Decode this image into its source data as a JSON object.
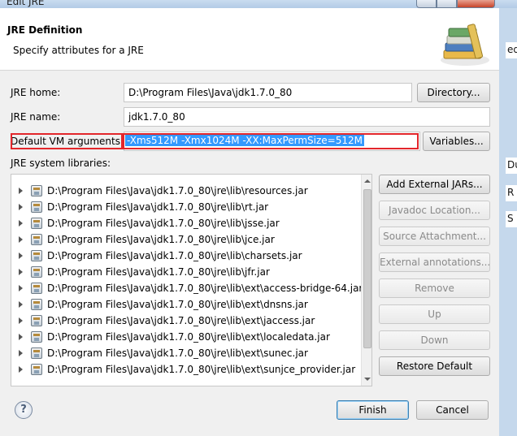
{
  "window": {
    "title": "Edit JRE"
  },
  "header": {
    "title": "JRE Definition",
    "subtitle": "Specify attributes for a JRE"
  },
  "form": {
    "jre_home_label": "JRE home:",
    "jre_home_value": "D:\\Program Files\\Java\\jdk1.7.0_80",
    "directory_button": "Directory...",
    "jre_name_label": "JRE name:",
    "jre_name_value": "jdk1.7.0_80",
    "vm_args_label": "Default VM arguments:",
    "vm_args_value": "-Xms512M -Xmx1024M -XX:MaxPermSize=512M",
    "variables_button": "Variables...",
    "libraries_label": "JRE system libraries:"
  },
  "libraries": [
    "D:\\Program Files\\Java\\jdk1.7.0_80\\jre\\lib\\resources.jar",
    "D:\\Program Files\\Java\\jdk1.7.0_80\\jre\\lib\\rt.jar",
    "D:\\Program Files\\Java\\jdk1.7.0_80\\jre\\lib\\jsse.jar",
    "D:\\Program Files\\Java\\jdk1.7.0_80\\jre\\lib\\jce.jar",
    "D:\\Program Files\\Java\\jdk1.7.0_80\\jre\\lib\\charsets.jar",
    "D:\\Program Files\\Java\\jdk1.7.0_80\\jre\\lib\\jfr.jar",
    "D:\\Program Files\\Java\\jdk1.7.0_80\\jre\\lib\\ext\\access-bridge-64.jar",
    "D:\\Program Files\\Java\\jdk1.7.0_80\\jre\\lib\\ext\\dnsns.jar",
    "D:\\Program Files\\Java\\jdk1.7.0_80\\jre\\lib\\ext\\jaccess.jar",
    "D:\\Program Files\\Java\\jdk1.7.0_80\\jre\\lib\\ext\\localedata.jar",
    "D:\\Program Files\\Java\\jdk1.7.0_80\\jre\\lib\\ext\\sunec.jar",
    "D:\\Program Files\\Java\\jdk1.7.0_80\\jre\\lib\\ext\\sunjce_provider.jar"
  ],
  "side_buttons": {
    "add_external_jars": "Add External JARs...",
    "javadoc_location": "Javadoc Location...",
    "source_attachment": "Source Attachment...",
    "external_annotations": "External annotations...",
    "remove": "Remove",
    "up": "Up",
    "down": "Down",
    "restore_default": "Restore Default"
  },
  "footer": {
    "help_icon": "?",
    "finish": "Finish",
    "cancel": "Cancel"
  },
  "background_peek": [
    "ed",
    "Du",
    "R",
    "S"
  ],
  "colors": {
    "selection": "#3399ff",
    "highlight_box": "#e3262b"
  }
}
